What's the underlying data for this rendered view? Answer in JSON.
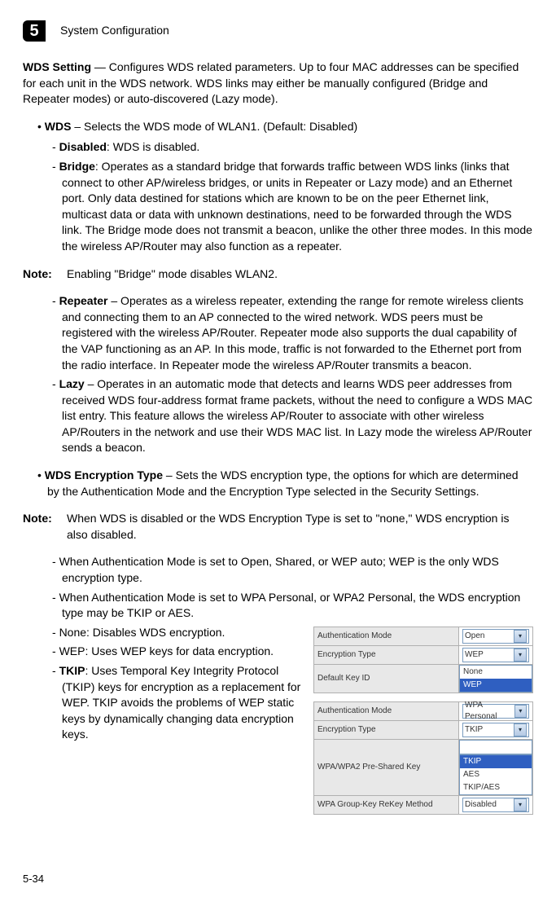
{
  "header": {
    "chapter": "5",
    "title": "System Configuration"
  },
  "wds_setting": {
    "heading": "WDS Setting",
    "text": " — Configures WDS related parameters. Up to four MAC addresses can be specified for each unit in the WDS network. WDS links may either be manually configured (Bridge and Repeater modes) or auto-discovered (Lazy mode)."
  },
  "wds": {
    "heading": "WDS",
    "text": " – Selects the WDS mode of WLAN1. (Default: Disabled)"
  },
  "disabled": {
    "heading": "Disabled",
    "text": ": WDS is disabled."
  },
  "bridge": {
    "heading": "Bridge",
    "text": ": Operates as a standard bridge that forwards traffic between WDS links (links that connect to other AP/wireless bridges, or units in Repeater or Lazy mode) and an Ethernet port. Only data destined for stations which are known to be on the peer Ethernet link, multicast data or data with unknown destinations, need to be forwarded through the WDS link. The Bridge mode does not transmit a beacon, unlike the other three modes. In this mode the wireless AP/Router may also function as a repeater."
  },
  "note1": {
    "label": "Note:",
    "text": "Enabling \"Bridge\" mode disables WLAN2."
  },
  "repeater": {
    "heading": "Repeater",
    "text": " – Operates as a wireless repeater, extending the range for remote wireless clients and connecting them to an AP connected to the wired network. WDS peers must be registered with the wireless AP/Router. Repeater mode also supports the dual capability of the VAP functioning as an AP. In this mode, traffic is not forwarded to the Ethernet port from the radio interface. In Repeater mode the wireless AP/Router transmits a beacon."
  },
  "lazy": {
    "heading": "Lazy",
    "text": " – Operates in an automatic mode that detects and learns WDS peer addresses from received WDS four-address format frame packets, without the need to configure a WDS MAC list entry. This feature allows the wireless AP/Router to associate with other wireless AP/Routers in the network and use their WDS MAC list. In Lazy mode the wireless AP/Router sends a beacon."
  },
  "enc_type": {
    "heading": "WDS Encryption Type",
    "text": " – Sets the WDS encryption type, the options for which are determined by the Authentication Mode and the Encryption Type selected in the Security Settings."
  },
  "note2": {
    "label": "Note:",
    "text": "When WDS is disabled or the WDS Encryption Type is set to \"none,\" WDS encryption is also disabled."
  },
  "sub1": "When Authentication Mode is set to Open, Shared, or WEP auto; WEP is the only WDS encryption type.",
  "sub2": "When Authentication Mode is set to WPA Personal, or WPA2 Personal, the WDS encryption type may be TKIP or AES.",
  "sub3": "None: Disables WDS encryption.",
  "sub4": "WEP: Uses WEP keys for data encryption.",
  "tkip": {
    "heading": "TKIP",
    "text": ": Uses Temporal Key Integrity Protocol (TKIP) keys for encryption as a replacement for WEP. TKIP avoids the problems of WEP static keys by dynamically changing data encryption keys."
  },
  "ui1": {
    "r1l": "Authentication Mode",
    "r1v": "Open",
    "r2l": "Encryption Type",
    "r2v": "WEP",
    "r3l": "Default Key ID",
    "drop": [
      "None",
      "WEP"
    ]
  },
  "ui2": {
    "r1l": "Authentication Mode",
    "r1v": "WPA Personal",
    "r2l": "Encryption Type",
    "r2v": "TKIP",
    "r3l": "WPA/WPA2 Pre-Shared Key",
    "r4l": "WPA Group-Key ReKey Method",
    "r4v": "Disabled",
    "drop": [
      "TKIP",
      "AES",
      "TKIP/AES"
    ]
  },
  "page_num": "5-34"
}
